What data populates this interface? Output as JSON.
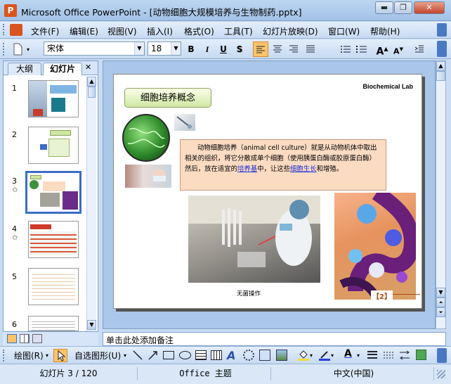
{
  "window": {
    "title": "Microsoft Office PowerPoint - [动物细胞大规模培养与生物制药.pptx]",
    "app_icon_letter": "P",
    "minimize": "▬",
    "restore": "❐",
    "close": "✕"
  },
  "menu": [
    "文件(F)",
    "编辑(E)",
    "视图(V)",
    "插入(I)",
    "格式(O)",
    "工具(T)",
    "幻灯片放映(D)",
    "窗口(W)",
    "帮助(H)"
  ],
  "toolbar": {
    "font_name": "宋体",
    "font_size": "18",
    "bold": "B",
    "italic": "I",
    "underline": "U",
    "shadow": "S"
  },
  "left_pane": {
    "tab_outline": "大纲",
    "tab_slides": "幻灯片",
    "close": "✕",
    "slide_numbers": [
      "1",
      "2",
      "3",
      "4",
      "5",
      "6"
    ],
    "selected_slide": 3,
    "anim_mark": "✩"
  },
  "slide": {
    "title": "细胞培养概念",
    "lab_label": "Biochemical Lab",
    "body_pre": "动物细胞培养（animal cell culture）就是从动物机体中取出相关的组织，将它分散成单个细胞（使用胰蛋白酶或胶原蛋白酶）然后，放在适宜的",
    "body_link1": "培养基",
    "body_mid": "中，让这些",
    "body_link2": "细胞生长",
    "body_post": "和增殖。",
    "photo_caption": "无菌操作",
    "page_number": "【2】"
  },
  "notes": {
    "placeholder": "单击此处添加备注"
  },
  "draw_toolbar": {
    "draw_label": "绘图(R)",
    "autoshape_label": "自选图形(U)"
  },
  "status": {
    "slide_counter": "幻灯片 3 / 120",
    "theme": "Office 主题",
    "language": "中文(中国)"
  },
  "colors": {
    "accent": "#3b6dc5",
    "title_box_green": "#cfe7a2",
    "text_box_peach": "#fbdbc2",
    "link": "#1b32d8"
  }
}
